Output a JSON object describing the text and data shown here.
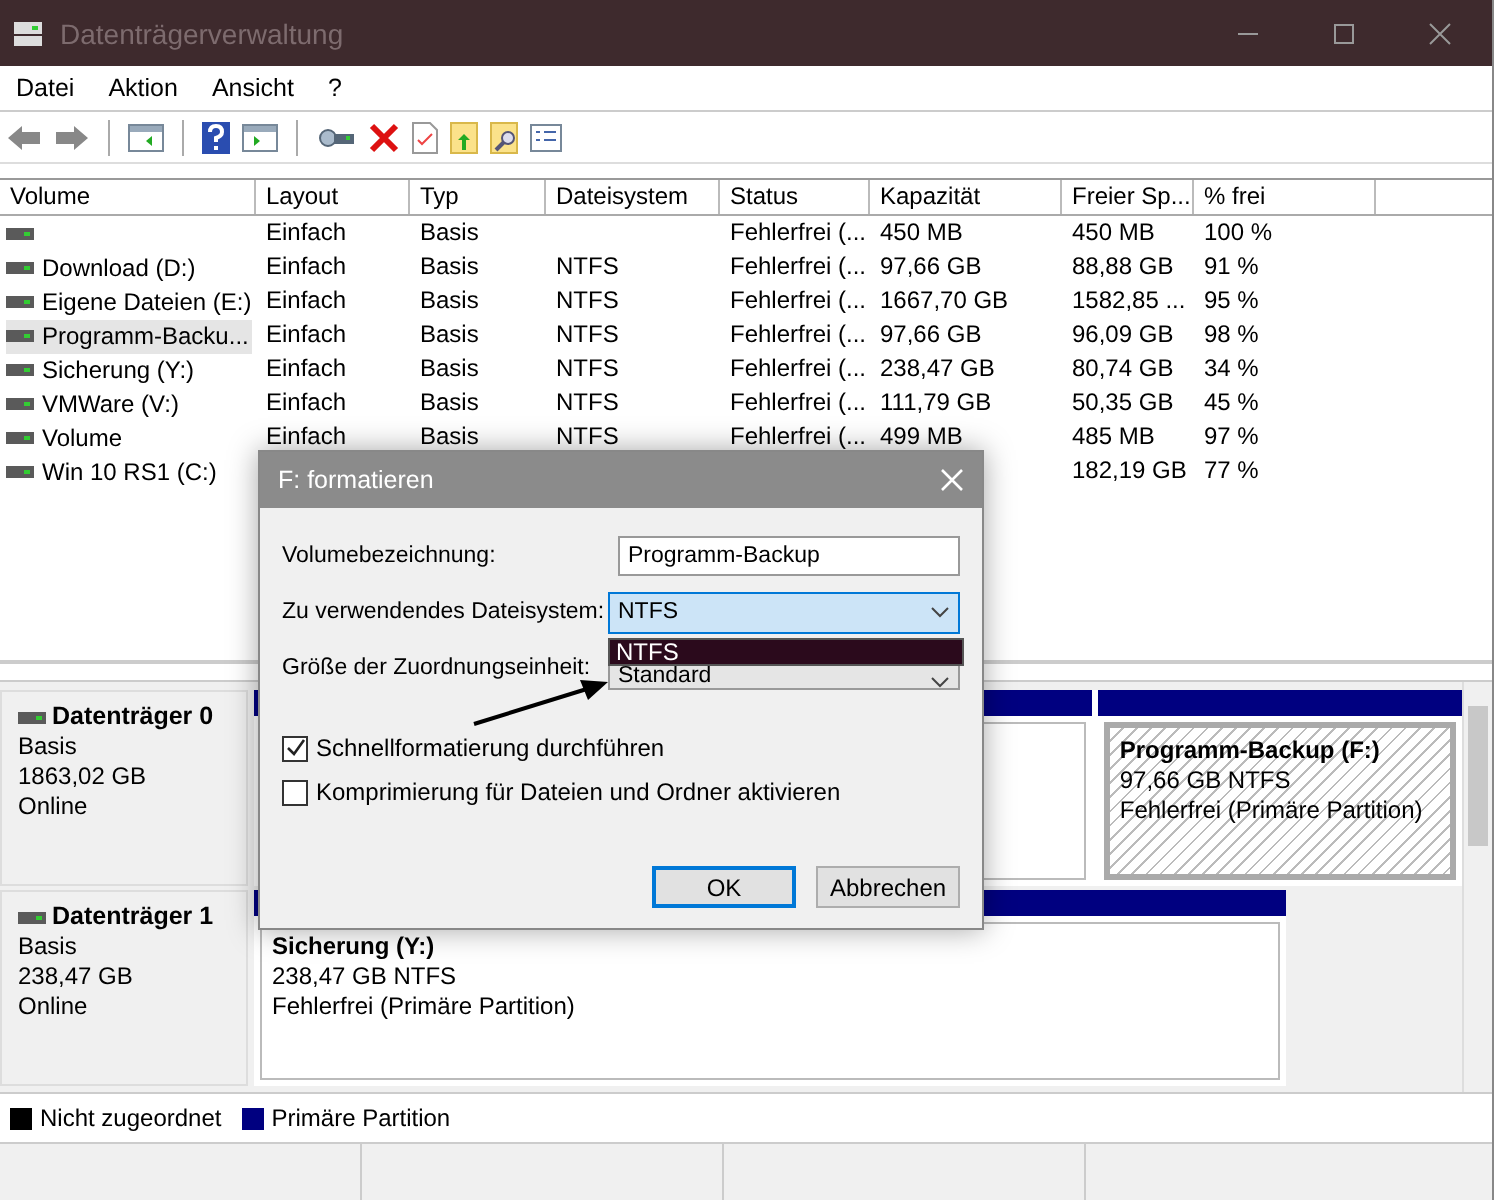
{
  "window": {
    "title": "Datenträgerverwaltung"
  },
  "menu": [
    "Datei",
    "Aktion",
    "Ansicht",
    "?"
  ],
  "toolbar": [
    {
      "kind": "back"
    },
    {
      "kind": "forward"
    },
    {
      "kind": "sep"
    },
    {
      "kind": "panel-left"
    },
    {
      "kind": "sep"
    },
    {
      "kind": "help"
    },
    {
      "kind": "panel-right"
    },
    {
      "kind": "sep"
    },
    {
      "kind": "drive"
    },
    {
      "kind": "delete"
    },
    {
      "kind": "check"
    },
    {
      "kind": "folder-up"
    },
    {
      "kind": "folder-search"
    },
    {
      "kind": "list"
    }
  ],
  "table": {
    "columns": [
      "Volume",
      "Layout",
      "Typ",
      "Dateisystem",
      "Status",
      "Kapazität",
      "Freier Sp...",
      "% frei"
    ],
    "rows": [
      {
        "selected": false,
        "cells": [
          "",
          "Einfach",
          "Basis",
          null,
          "Fehlerfrei (...",
          "450 MB",
          "450 MB",
          "100 %"
        ]
      },
      {
        "selected": false,
        "cells": [
          "Download (D:)",
          "Einfach",
          "Basis",
          "NTFS",
          "Fehlerfrei (...",
          "97,66 GB",
          "88,88 GB",
          "91 %"
        ]
      },
      {
        "selected": false,
        "cells": [
          "Eigene Dateien (E:)",
          "Einfach",
          "Basis",
          "NTFS",
          "Fehlerfrei (...",
          "1667,70 GB",
          "1582,85 ...",
          "95 %"
        ]
      },
      {
        "selected": true,
        "cells": [
          "Programm-Backu...",
          "Einfach",
          "Basis",
          "NTFS",
          "Fehlerfrei (...",
          "97,66 GB",
          "96,09 GB",
          "98 %"
        ]
      },
      {
        "selected": false,
        "cells": [
          "Sicherung (Y:)",
          "Einfach",
          "Basis",
          "NTFS",
          "Fehlerfrei (...",
          "238,47 GB",
          "80,74 GB",
          "34 %"
        ]
      },
      {
        "selected": false,
        "cells": [
          "VMWare (V:)",
          "Einfach",
          "Basis",
          "NTFS",
          "Fehlerfrei (...",
          "111,79 GB",
          "50,35 GB",
          "45 %"
        ]
      },
      {
        "selected": false,
        "cells": [
          "Volume",
          "Einfach",
          "Basis",
          "NTFS",
          "Fehlerfrei (...",
          "499 MB",
          "485 MB",
          "97 %"
        ]
      },
      {
        "selected": false,
        "cells": [
          "Win 10 RS1 (C:)",
          null,
          null,
          null,
          null,
          null,
          "182,19 GB",
          "77 %"
        ]
      }
    ]
  },
  "disks": [
    {
      "name": "Datenträger 0",
      "type": "Basis",
      "size": "1863,02 GB",
      "status": "Online",
      "partitions": [
        {
          "selected": false
        },
        {
          "selected": true,
          "name": "Programm-Backup  (F:)",
          "size": "97,66 GB NTFS",
          "status": "Fehlerfrei (Primäre Partition)"
        }
      ]
    },
    {
      "name": "Datenträger 1",
      "type": "Basis",
      "size": "238,47 GB",
      "status": "Online",
      "partitions": [
        {
          "selected": false,
          "name": "Sicherung  (Y:)",
          "size": "238,47 GB NTFS",
          "status": "Fehlerfrei (Primäre Partition)"
        }
      ]
    }
  ],
  "legend": [
    {
      "label": "Nicht zugeordnet",
      "color": "#000000"
    },
    {
      "label": "Primäre Partition",
      "color": "#000080"
    }
  ],
  "dialog": {
    "title": "F: formatieren",
    "volume_label": "Volumebezeichnung:",
    "volume_value": "Programm-Backup",
    "fs_label": "Zu verwendendes Dateisystem:",
    "fs_value": "NTFS",
    "fs_expanded": true,
    "fs_options": [
      {
        "label": "NTFS",
        "selected": true
      }
    ],
    "alloc_label": "Größe der Zuordnungseinheit:",
    "alloc_value": "Standard",
    "checkboxes": [
      {
        "label": "Schnellformatierung durchführen",
        "checked": true
      },
      {
        "label": "Komprimierung für Dateien und Ordner aktivieren",
        "checked": false
      }
    ],
    "buttons": [
      {
        "label": "OK",
        "default": true
      },
      {
        "label": "Abbrechen",
        "default": false
      }
    ]
  }
}
